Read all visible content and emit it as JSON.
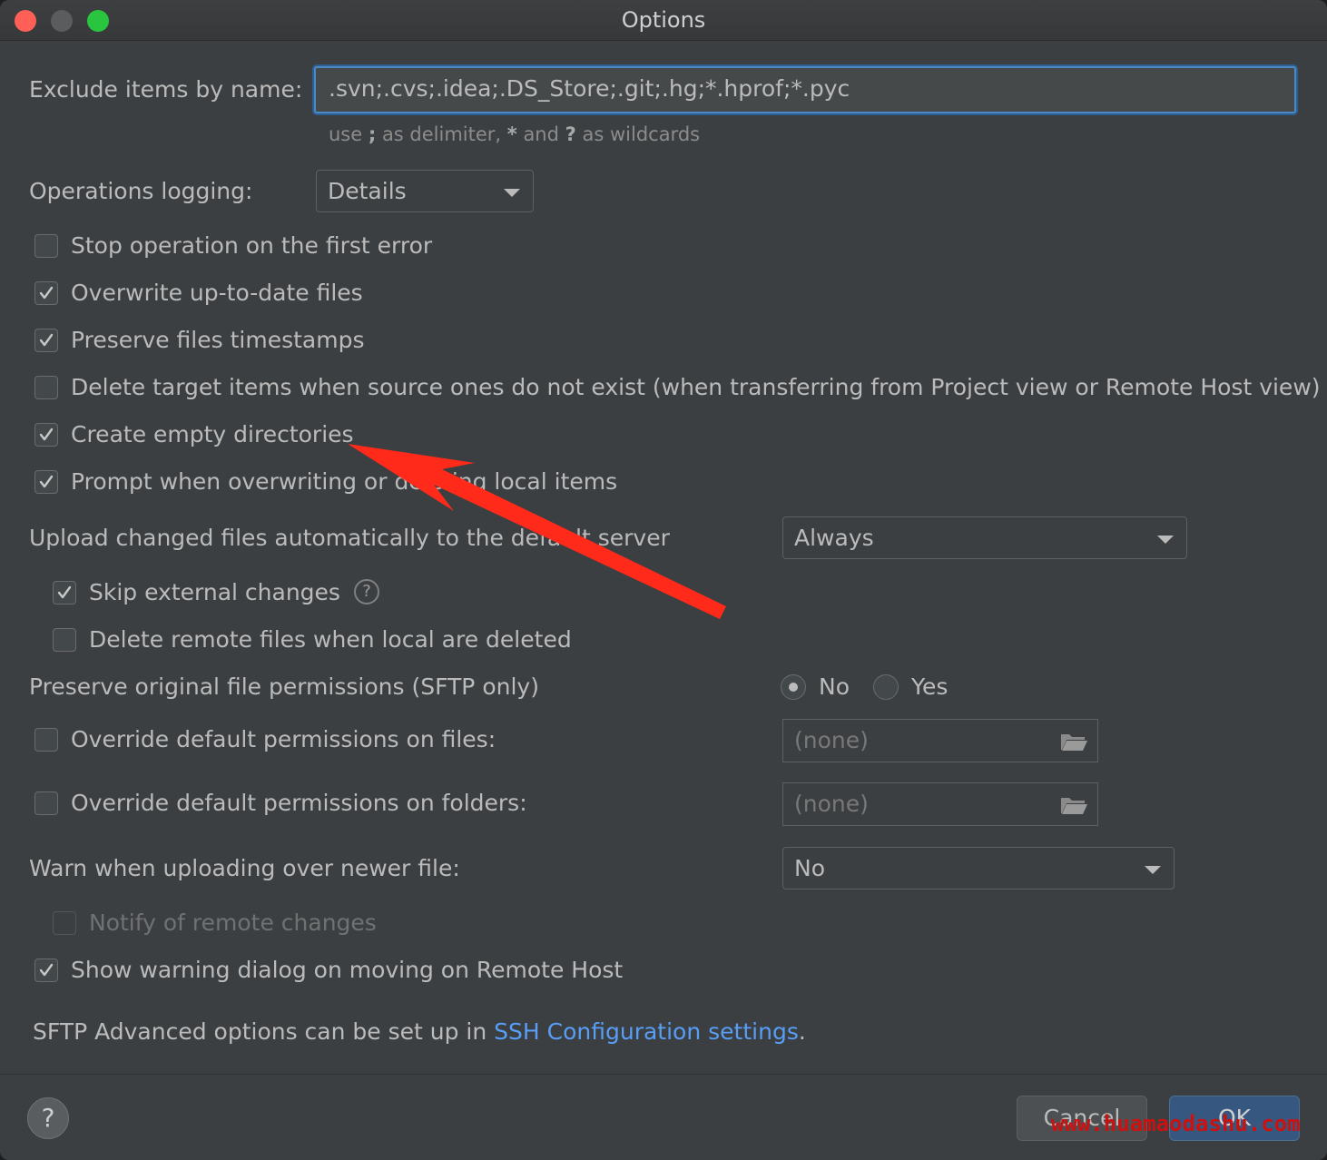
{
  "window": {
    "title": "Options"
  },
  "exclude": {
    "label": "Exclude items by name:",
    "value": ".svn;.cvs;.idea;.DS_Store;.git;.hg;*.hprof;*.pyc",
    "hint_prefix": "use ",
    "hint_delim": ";",
    "hint_mid": " as delimiter, ",
    "hint_star": "*",
    "hint_and": " and ",
    "hint_q": "?",
    "hint_suffix": " as wildcards"
  },
  "logging": {
    "label": "Operations logging:",
    "value": "Details"
  },
  "checkboxes": {
    "stop_first_error": {
      "label": "Stop operation on the first error",
      "checked": false
    },
    "overwrite_uptodate": {
      "label": "Overwrite up-to-date files",
      "checked": true
    },
    "preserve_timestamps": {
      "label": "Preserve files timestamps",
      "checked": true
    },
    "delete_target": {
      "label": "Delete target items when source ones do not exist (when transferring from Project view or Remote Host view)",
      "checked": false
    },
    "create_empty_dirs": {
      "label": "Create empty directories",
      "checked": true
    },
    "prompt_overwrite": {
      "label": "Prompt when overwriting or deleting local items",
      "checked": true
    },
    "skip_external": {
      "label": "Skip external changes",
      "checked": true
    },
    "delete_remote": {
      "label": "Delete remote files when local are deleted",
      "checked": false
    },
    "override_files": {
      "label": "Override default permissions on files:",
      "checked": false
    },
    "override_folders": {
      "label": "Override default permissions on folders:",
      "checked": false
    },
    "notify_remote": {
      "label": "Notify of remote changes",
      "checked": false,
      "disabled": true
    },
    "show_warning": {
      "label": "Show warning dialog on moving on Remote Host",
      "checked": true
    }
  },
  "upload": {
    "label": "Upload changed files automatically to the default server",
    "value": "Always"
  },
  "preserve_perms": {
    "label": "Preserve original file permissions (SFTP only)",
    "options": [
      "No",
      "Yes"
    ],
    "selected": "No"
  },
  "perm_files": {
    "value": "(none)"
  },
  "perm_folders": {
    "value": "(none)"
  },
  "warn_newer": {
    "label": "Warn when uploading over newer file:",
    "value": "No"
  },
  "footer": {
    "text_prefix": "SFTP Advanced options can be set up in ",
    "link": "SSH Configuration settings",
    "text_suffix": "."
  },
  "buttons": {
    "help": "?",
    "cancel": "Cancel",
    "ok": "OK"
  },
  "watermark": "www.huamaodashu.com",
  "colors": {
    "background": "#3c3f41",
    "accent": "#4a88c7",
    "link": "#589df6",
    "arrow": "#ff2a1a"
  }
}
